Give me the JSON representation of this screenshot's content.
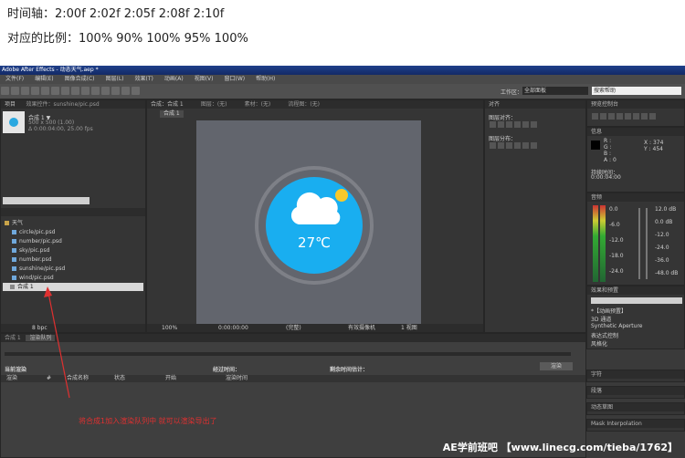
{
  "notes": {
    "timeline": "时间轴：2:00f 2:02f 2:05f 2:08f 2:10f",
    "ratio": "对应的比例：100% 90% 100% 95% 100%"
  },
  "app": {
    "title": "Adobe After Effects - 动态天气.aep *",
    "menu": [
      "文件(F)",
      "编辑(E)",
      "图像合成(C)",
      "图层(L)",
      "效果(T)",
      "动画(A)",
      "视图(V)",
      "窗口(W)",
      "帮助(H)"
    ],
    "workspace_label": "工作区：",
    "workspace_value": "全部面板",
    "search_help": "搜索帮助"
  },
  "project": {
    "tab": "项目",
    "effects_tab": "效果控件：sunshine/pic.psd",
    "comp_name": "合成 1 ▼",
    "comp_info1": "500 x 500 (1.00)",
    "comp_info2": "Δ 0:00:04:00, 25.00 fps",
    "folder": "天气",
    "files": [
      "circle/pic.psd",
      "number/pic.psd",
      "sky/pic.psd",
      "number.psd",
      "sunshine/pic.psd",
      "wind/pic.psd"
    ],
    "selected": "合成 1",
    "bpc": "8 bpc"
  },
  "composition": {
    "tabs": [
      "合成：合成 1",
      "图层：(无)",
      "素材：(无)",
      "流程图：(无)"
    ],
    "subtab": "合成 1",
    "temperature": "27℃",
    "zoom": "100%",
    "timecode": "0:00:00:00",
    "quality": "(完整)",
    "camera": "有效摄像机",
    "views": "1 视图"
  },
  "right": {
    "info_tab": "信息",
    "r": "R :",
    "g": "G :",
    "b": "B :",
    "a": "A : 0",
    "x": "X : 374",
    "y": "Y : 454",
    "duration_label": "持续时间：",
    "duration": "0:00:04:00",
    "preview_tab": "预览控制台",
    "audio_tab": "音频",
    "audio_scale": [
      "0.0",
      "-6.0",
      "-12.0",
      "-18.0",
      "-24.0"
    ],
    "audio_db": [
      "12.0 dB",
      "0.0 dB",
      "-12.0",
      "-24.0",
      "-36.0",
      "-48.0 dB"
    ],
    "effects_tab": "效果和预置",
    "presets": [
      "*【动画预置】",
      "3D 通道",
      "Synthetic Aperture",
      "表达式控制",
      "风格化"
    ],
    "align_tab": "对齐",
    "char_tab": "字符",
    "para_tab": "段落",
    "motion_tab": "动态草图",
    "mask_tab": "Mask Interpolation"
  },
  "middle": {
    "align_label": "图层对齐：",
    "distribute_label": "图层分布："
  },
  "render": {
    "tabs": [
      "合成 1",
      "渲染队列"
    ],
    "current_label": "当前渲染",
    "elapsed_label": "经过时间：",
    "remaining_label": "剩余时间估计：",
    "render_button": "渲染",
    "columns": [
      "渲染",
      "#",
      "合成名称",
      "状态",
      "开始",
      "渲染时间"
    ]
  },
  "annotation": "将合成1加入渲染队列中 就可以渲染导出了",
  "watermark": "AE学前班吧 【www.linecg.com/tieba/1762】"
}
